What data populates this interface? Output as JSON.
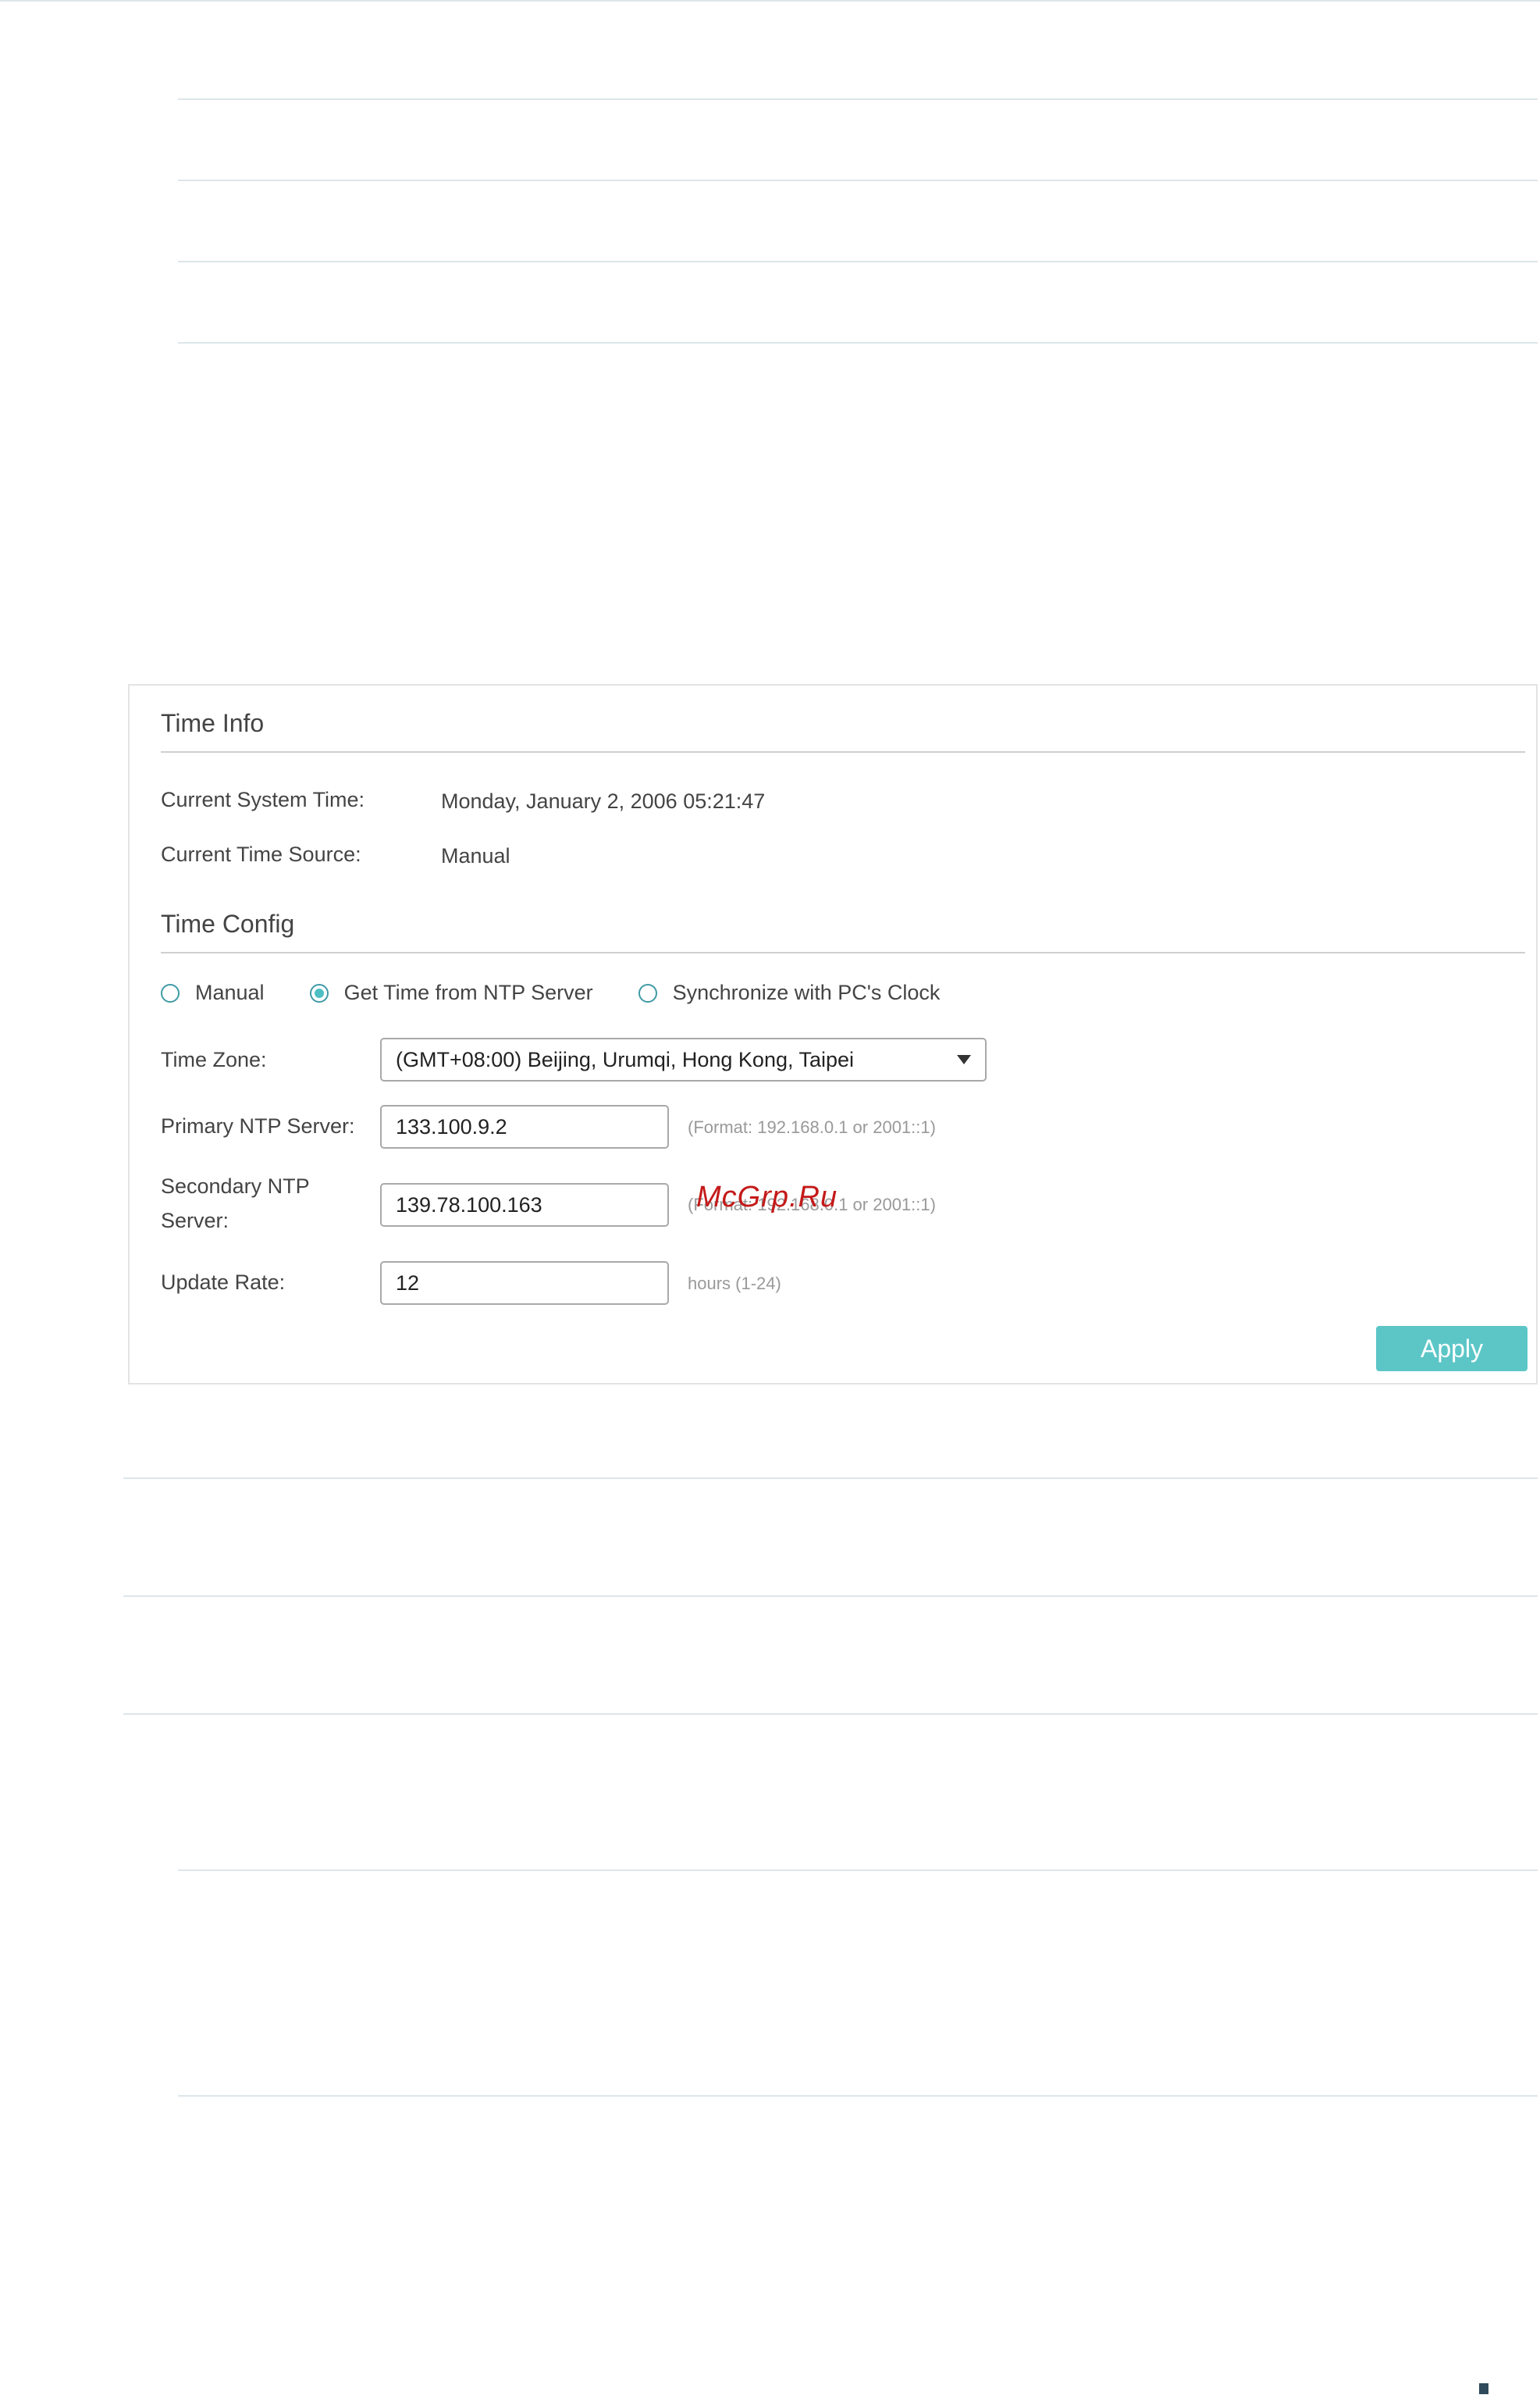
{
  "time_info": {
    "title": "Time Info",
    "current_system_time_label": "Current System Time:",
    "current_system_time_value": "Monday, January 2, 2006 05:21:47",
    "current_time_source_label": "Current Time Source:",
    "current_time_source_value": "Manual"
  },
  "time_config": {
    "title": "Time Config",
    "mode_options": [
      {
        "label": "Manual",
        "checked": false
      },
      {
        "label": "Get Time from NTP Server",
        "checked": true
      },
      {
        "label": "Synchronize with PC's Clock",
        "checked": false
      }
    ],
    "time_zone_label": "Time Zone:",
    "time_zone_value": "(GMT+08:00) Beijing, Urumqi, Hong Kong, Taipei",
    "primary_ntp_label": "Primary NTP Server:",
    "primary_ntp_value": "133.100.9.2",
    "primary_ntp_hint": "(Format: 192.168.0.1 or 2001::1)",
    "secondary_ntp_label_line1": "Secondary NTP",
    "secondary_ntp_label_line2": "Server:",
    "secondary_ntp_value": "139.78.100.163",
    "secondary_ntp_hint": "(Format: 192.168.0.1 or 2001::1)",
    "update_rate_label": "Update Rate:",
    "update_rate_value": "12",
    "update_rate_hint": "hours (1-24)",
    "apply_label": "Apply"
  },
  "watermark_text": "McGrp.Ru"
}
